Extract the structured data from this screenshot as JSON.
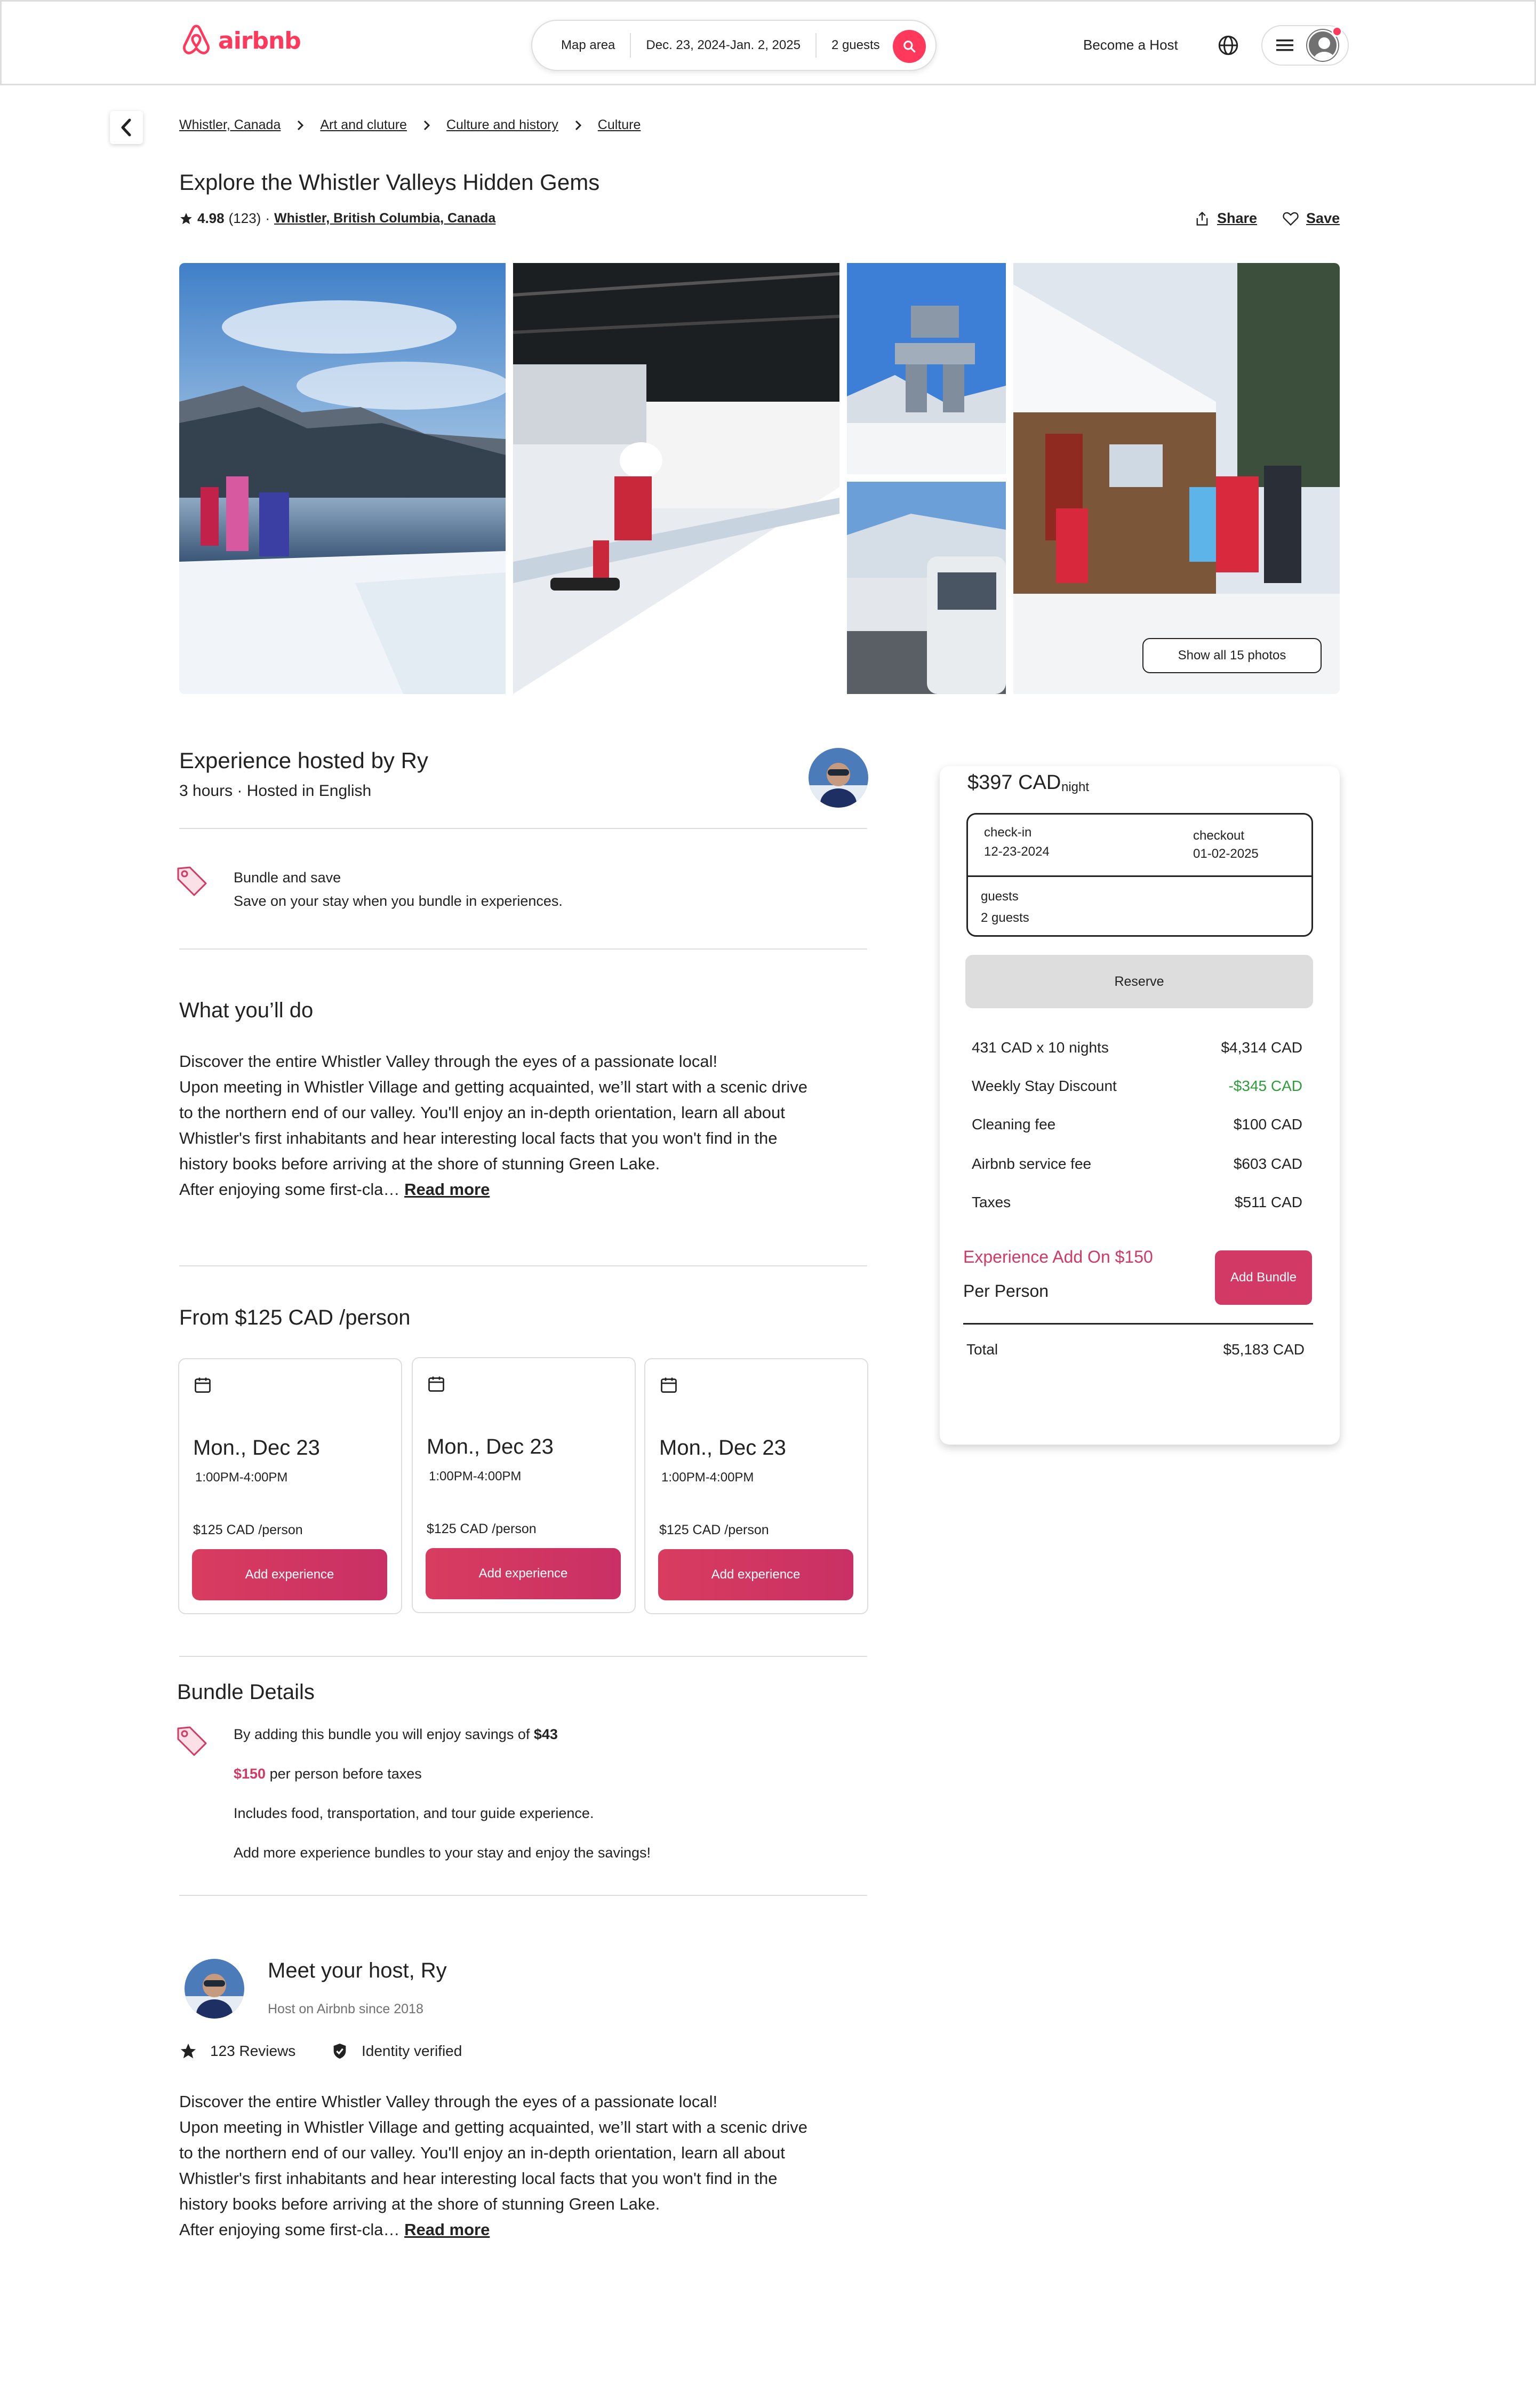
{
  "header": {
    "brand": "airbnb",
    "search": {
      "location": "Map area",
      "dates": "Dec. 23, 2024-Jan. 2, 2025",
      "guests": "2 guests"
    },
    "become_host": "Become a Host"
  },
  "breadcrumb": [
    "Whistler, Canada",
    "Art and cluture",
    "Culture and history",
    "Culture"
  ],
  "listing": {
    "title": "Explore the Whistler Valleys Hidden Gems",
    "rating": "4.98",
    "reviews": "(123)",
    "separator": "·",
    "location": "Whistler, British Columbia, Canada",
    "share_label": "Share",
    "save_label": "Save",
    "show_all_photos": "Show all 15 photos"
  },
  "host_summary": {
    "title": "Experience hosted by Ry",
    "meta": "3 hours · Hosted in English"
  },
  "bundle_promo": {
    "title": "Bundle and save",
    "subtitle": "Save on your stay when you bundle in experiences."
  },
  "what_youll_do": {
    "heading": "What you’ll do",
    "lines": [
      "Discover the entire Whistler Valley through the eyes of a passionate local!",
      "Upon meeting in Whistler Village and getting acquainted, we’ll start with a scenic drive",
      "to the northern end of our valley. You'll enjoy an in-depth orientation, learn all about",
      "Whistler's first inhabitants and hear interesting local facts that you won't find in the",
      "history books before arriving at the shore of stunning Green Lake.",
      "After enjoying some first-cla… "
    ],
    "read_more": "Read more"
  },
  "availability": {
    "heading": "From $125 CAD /person",
    "slots": [
      {
        "date": "Mon., Dec 23",
        "time": "1:00PM-4:00PM",
        "price": "$125 CAD /person",
        "button": "Add experience"
      },
      {
        "date": "Mon., Dec 23",
        "time": "1:00PM-4:00PM",
        "price": "$125 CAD /person",
        "button": "Add experience"
      },
      {
        "date": "Mon., Dec 23",
        "time": "1:00PM-4:00PM",
        "price": "$125 CAD /person",
        "button": "Add experience"
      }
    ]
  },
  "bundle_details": {
    "heading": "Bundle Details",
    "savings_prefix": "By adding this bundle you will enjoy savings of ",
    "savings_amount": "$43",
    "price": "$150",
    "price_suffix": " per person before taxes",
    "includes": "Includes food, transportation, and tour guide experience.",
    "more": "Add more experience bundles to your stay and enjoy the savings!"
  },
  "meet_host": {
    "heading": "Meet your host, Ry",
    "since": "Host on Airbnb since 2018",
    "reviews": "123 Reviews",
    "verified": "Identity verified",
    "lines": [
      "Discover the entire Whistler Valley through the eyes of a passionate local!",
      "Upon meeting in Whistler Village and getting acquainted, we’ll start with a scenic drive",
      "to the northern end of our valley. You'll enjoy an in-depth orientation, learn all about",
      "Whistler's first inhabitants and hear interesting local facts that you won't find in the",
      "history books before arriving at the shore of stunning Green Lake.",
      "After enjoying some first-cla… "
    ],
    "read_more": "Read more"
  },
  "booking": {
    "price": "$397 CAD",
    "per": "night",
    "checkin_label": "check-in",
    "checkin_value": "12-23-2024",
    "checkout_label": "checkout",
    "checkout_value": "01-02-2025",
    "guests_label": "guests",
    "guests_value": "2 guests",
    "reserve": "Reserve",
    "fees": [
      {
        "label": "431 CAD x 10 nights",
        "value": "$4,314 CAD"
      },
      {
        "label": "Weekly Stay Discount",
        "value": "-$345 CAD"
      },
      {
        "label": "Cleaning fee",
        "value": "$100 CAD"
      },
      {
        "label": "Airbnb service fee",
        "value": "$603 CAD"
      },
      {
        "label": "Taxes",
        "value": "$511 CAD"
      }
    ],
    "addon_title": "Experience Add On $150",
    "addon_sub": "Per Person",
    "addon_button": "Add Bundle",
    "total_label": "Total",
    "total_value": "$5,183 CAD"
  },
  "colors": {
    "brand": "#ff385c",
    "accent_pink": "#d23964",
    "discount_green": "#2e9c3b",
    "border": "#dddddd"
  },
  "icons": [
    "airbnb-logo-icon",
    "search-icon",
    "globe-icon",
    "hamburger-icon",
    "user-icon",
    "chevron-left-icon",
    "chevron-right-icon",
    "star-icon",
    "share-icon",
    "heart-icon",
    "price-tag-icon",
    "calendar-icon",
    "shield-check-icon"
  ]
}
